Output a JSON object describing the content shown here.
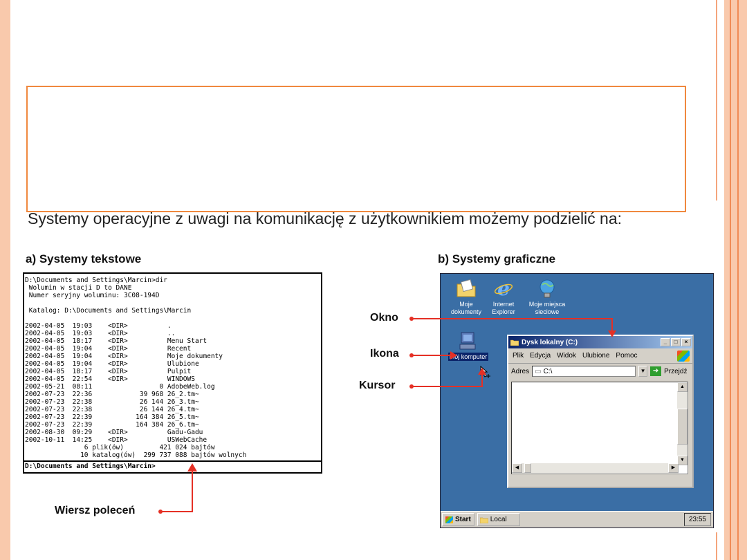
{
  "intro": "Systemy operacyjne z uwagi na komunikację z użytkownikiem możemy podzielić na:",
  "text_section": {
    "heading": "a) Systemy tekstowe",
    "console_lines": [
      "D:\\Documents and Settings\\Marcin>dir",
      " Wolumin w stacji D to DANE",
      " Numer seryjny woluminu: 3C08-194D",
      "",
      " Katalog: D:\\Documents and Settings\\Marcin",
      "",
      "2002-04-05  19:03    <DIR>          .",
      "2002-04-05  19:03    <DIR>          ..",
      "2002-04-05  18:17    <DIR>          Menu Start",
      "2002-04-05  19:04    <DIR>          Recent",
      "2002-04-05  19:04    <DIR>          Moje dokumenty",
      "2002-04-05  19:04    <DIR>          Ulubione",
      "2002-04-05  18:17    <DIR>          Pulpit",
      "2002-04-05  22:54    <DIR>          WINDOWS",
      "2002-05-21  08:11                 0 AdobeWeb.log",
      "2002-07-23  22:36            39 968 26_2.tm~",
      "2002-07-23  22:38            26 144 26_3.tm~",
      "2002-07-23  22:38            26 144 26_4.tm~",
      "2002-07-23  22:39           164 384 26_5.tm~",
      "2002-07-23  22:39           164 384 26_6.tm~",
      "2002-08-30  09:29    <DIR>          Gadu-Gadu",
      "2002-10-11  14:25    <DIR>          USWebCache",
      "               6 plik(ów)         421 024 bajtów",
      "              10 katalog(ów)  299 737 088 bajtów wolnych"
    ],
    "prompt": "D:\\Documents and Settings\\Marcin>",
    "callout": "Wiersz poleceń"
  },
  "gui_section": {
    "heading": "b) Systemy graficzne",
    "callouts": {
      "window": "Okno",
      "icon": "Ikona",
      "cursor": "Kursor"
    },
    "desktop_icons": [
      {
        "label": "Moje dokumenty",
        "icon": "folder-documents-icon"
      },
      {
        "label": "Internet Explorer",
        "icon": "internet-explorer-icon"
      },
      {
        "label": "Moje miejsca sieciowe",
        "icon": "network-places-icon"
      },
      {
        "label": "Mój komputer",
        "icon": "my-computer-icon"
      }
    ],
    "window": {
      "title": "Dysk lokalny (C:)",
      "menu": [
        "Plik",
        "Edycja",
        "Widok",
        "Ulubione",
        "Pomoc"
      ],
      "address_label": "Adres",
      "address_value": "C:\\",
      "go_label": "Przejdź"
    },
    "taskbar": {
      "start": "Start",
      "task": "Local",
      "clock": "23:55"
    }
  },
  "colors": {
    "accent": "#f0883e",
    "callout_red": "#e53025",
    "desktop_blue": "#3a6ea5"
  }
}
